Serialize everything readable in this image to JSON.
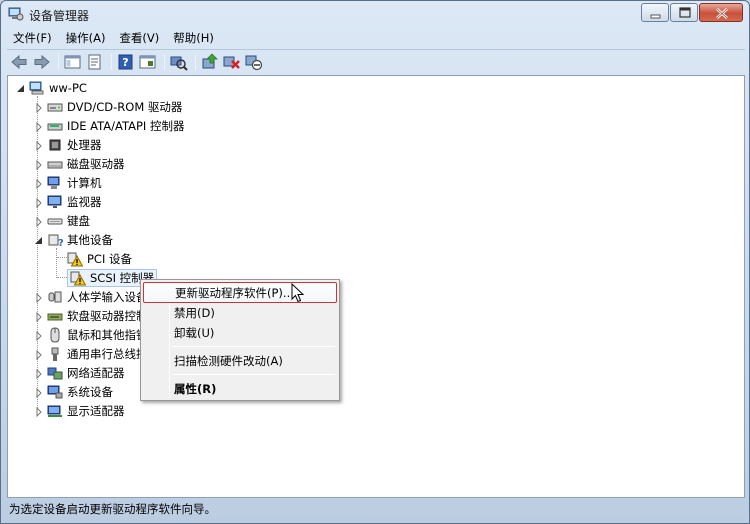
{
  "window": {
    "title": "设备管理器",
    "icon": "device-manager-icon"
  },
  "menubar": [
    "文件(F)",
    "操作(A)",
    "查看(V)",
    "帮助(H)"
  ],
  "toolbar": [
    "back-arrow-icon",
    "forward-arrow-icon",
    "show-hide-tree-icon",
    "properties-icon",
    "help-icon",
    "view-icon",
    "scan-hardware-icon",
    "update-driver-icon",
    "uninstall-icon",
    "disable-icon"
  ],
  "tree": {
    "root": "ww-PC",
    "categories": [
      {
        "label": "DVD/CD-ROM 驱动器",
        "icon": "dvd-drive-icon"
      },
      {
        "label": "IDE ATA/ATAPI 控制器",
        "icon": "ide-controller-icon"
      },
      {
        "label": "处理器",
        "icon": "processor-icon"
      },
      {
        "label": "磁盘驱动器",
        "icon": "disk-drive-icon"
      },
      {
        "label": "计算机",
        "icon": "computer-icon"
      },
      {
        "label": "监视器",
        "icon": "monitor-icon"
      },
      {
        "label": "键盘",
        "icon": "keyboard-icon"
      },
      {
        "label": "其他设备",
        "icon": "other-devices-icon",
        "expanded": true,
        "children": [
          {
            "label": "PCI 设备",
            "icon": "warning-device-icon"
          },
          {
            "label": "SCSI 控制器",
            "icon": "warning-device-icon",
            "selected": true
          }
        ]
      },
      {
        "label": "人体学输入设备",
        "icon": "hid-icon"
      },
      {
        "label": "软盘驱动器控制器",
        "icon": "floppy-controller-icon"
      },
      {
        "label": "鼠标和其他指针设备",
        "icon": "mouse-icon"
      },
      {
        "label": "通用串行总线控制器",
        "icon": "usb-icon"
      },
      {
        "label": "网络适配器",
        "icon": "network-adapter-icon"
      },
      {
        "label": "系统设备",
        "icon": "system-devices-icon"
      },
      {
        "label": "显示适配器",
        "icon": "display-adapter-icon"
      }
    ]
  },
  "context_menu": {
    "items": [
      {
        "label": "更新驱动程序软件(P)...",
        "hover": true
      },
      {
        "label": "禁用(D)"
      },
      {
        "label": "卸载(U)"
      },
      {
        "label": "扫描检测硬件改动(A)"
      },
      {
        "label": "属性(R)",
        "bold": true
      }
    ]
  },
  "statusbar": {
    "text": "为选定设备启动更新驱动程序软件向导。"
  },
  "colors": {
    "accent": "#3a6ea5",
    "warning": "#f2c811",
    "menu_hover_border": "#c9343a"
  }
}
